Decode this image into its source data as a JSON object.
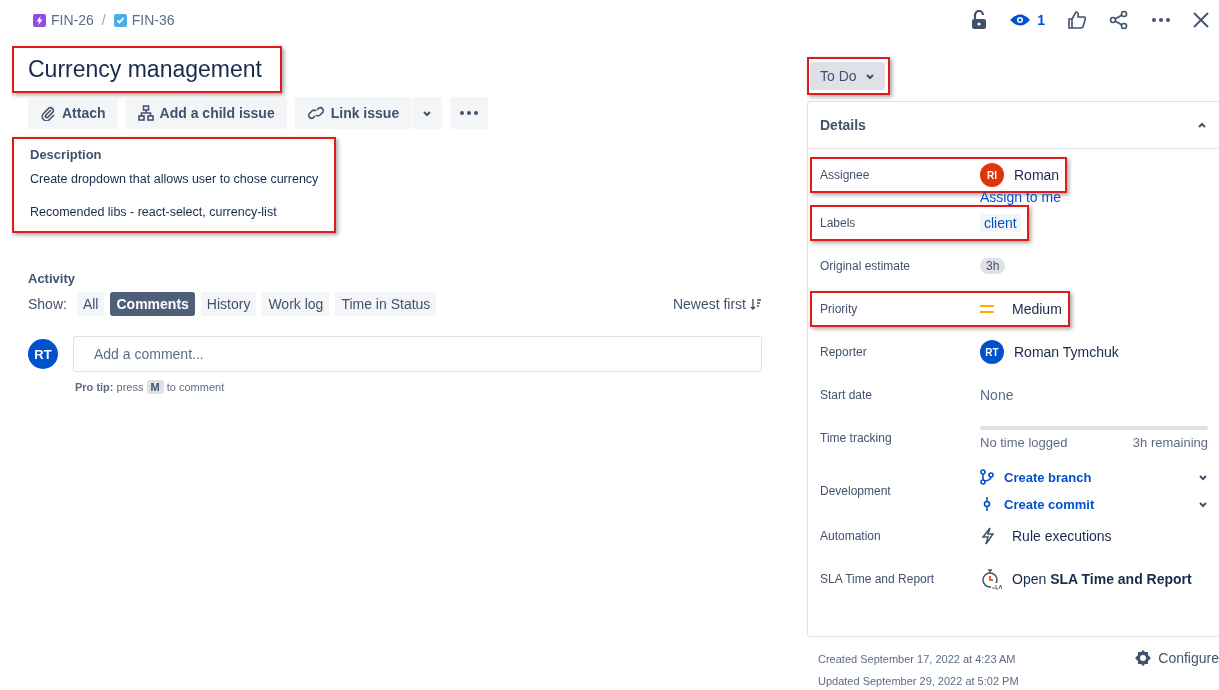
{
  "breadcrumb_separator": "/",
  "breadcrumbs": [
    {
      "kind": "epic",
      "key": "FIN-26"
    },
    {
      "kind": "task",
      "key": "FIN-36"
    }
  ],
  "header": {
    "watchers": "1"
  },
  "title": {
    "text": "Currency management",
    "highlighted": true
  },
  "toolbar": [
    {
      "kind": "attach",
      "label": "Attach"
    },
    {
      "kind": "child",
      "label": "Add a child issue"
    },
    {
      "kind": "link",
      "label": "Link issue"
    }
  ],
  "description": {
    "heading": "Description",
    "paragraphs": [
      "Create dropdown that allows user to chose currency",
      "Recomended libs - react-select, currency-list"
    ],
    "highlighted": true
  },
  "activity": {
    "heading": "Activity",
    "show_label": "Show:",
    "filters": [
      {
        "label": "All",
        "selected": false
      },
      {
        "label": "Comments",
        "selected": true
      },
      {
        "label": "History",
        "selected": false
      },
      {
        "label": "Work log",
        "selected": false
      },
      {
        "label": "Time in Status",
        "selected": false
      }
    ],
    "sort": "Newest first",
    "avatar": "RT",
    "placeholder": "Add a comment...",
    "tip": "**Pro tip:** press",
    "tip_key": "M",
    "tip_end": "to comment"
  },
  "status": {
    "label": "To Do",
    "highlighted": true
  },
  "details": {
    "heading": "Details",
    "fields": [
      {
        "kind": "user",
        "label": "Assignee",
        "initials": "RI",
        "color": "#de350b",
        "name": "Roman",
        "link": "Assign to me",
        "highlighted": true
      },
      {
        "kind": "tag",
        "label": "Labels",
        "value": "client",
        "highlighted": true
      },
      {
        "kind": "estimate",
        "label": "Original estimate",
        "value": "3h",
        "highlighted": false
      },
      {
        "kind": "priority",
        "label": "Priority",
        "value": "Medium",
        "highlighted": true
      },
      {
        "kind": "user",
        "label": "Reporter",
        "initials": "RT",
        "color": "#0052cc",
        "name": "Roman Tymchuk",
        "highlighted": false
      },
      {
        "kind": "text",
        "label": "Start date",
        "value": "None",
        "highlighted": false
      },
      {
        "kind": "tracking",
        "label": "Time tracking",
        "level": 0,
        "logged": "No time logged",
        "remaining": "3h remaining",
        "highlighted": false
      },
      {
        "kind": "dev",
        "label": "Development",
        "links": [
          {
            "kind": "branch",
            "label": "Create branch"
          },
          {
            "kind": "commit",
            "label": "Create commit"
          }
        ],
        "highlighted": false
      },
      {
        "kind": "automation",
        "label": "Automation",
        "value": "Rule executions",
        "highlighted": false
      },
      {
        "kind": "sla",
        "label": "SLA Time and Report",
        "value": "Open **SLA Time and Report**",
        "highlighted": false
      }
    ]
  },
  "footer": {
    "created": "Created September 17, 2022 at 4:23 AM",
    "updated": "Updated September 29, 2022 at 5:02 PM",
    "configure": "Configure"
  }
}
